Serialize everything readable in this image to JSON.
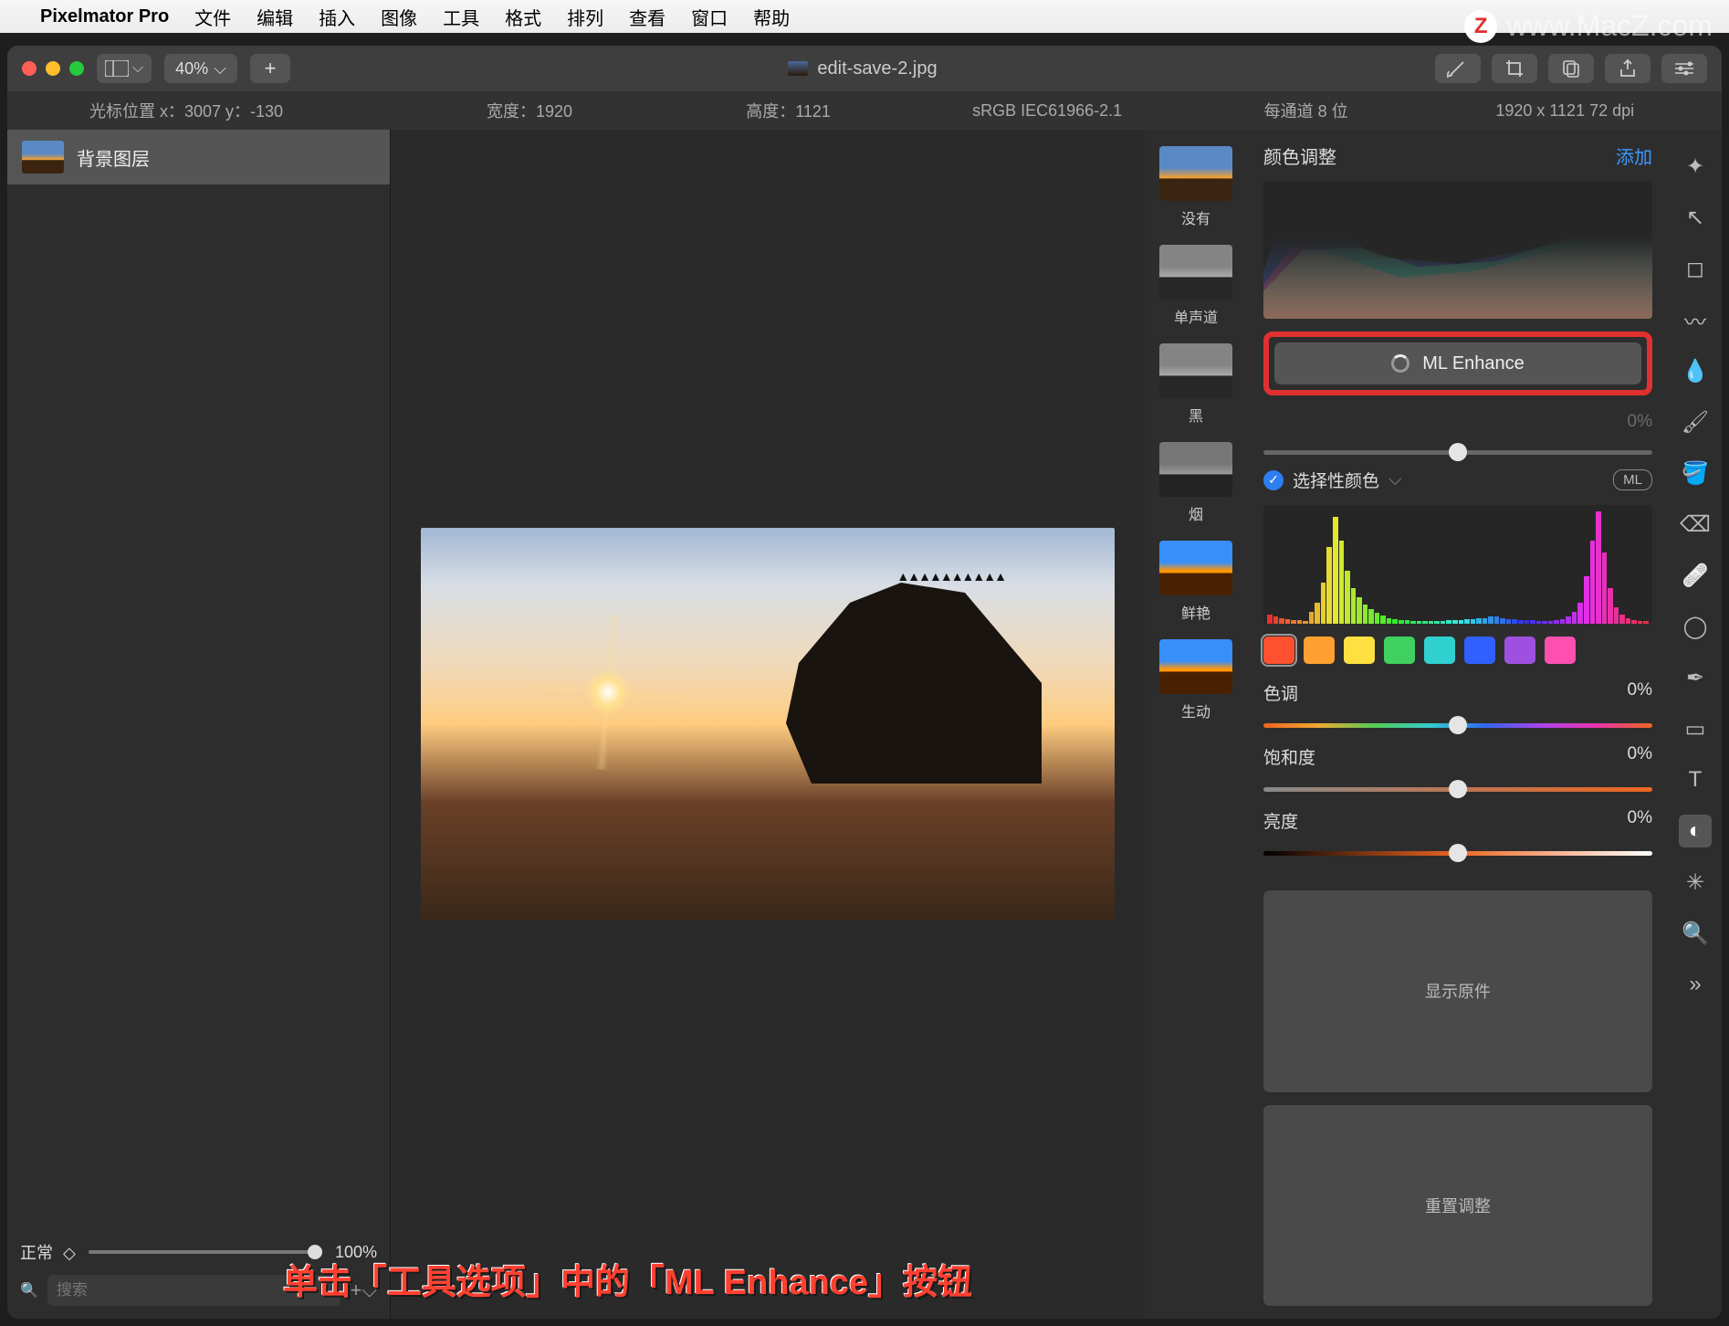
{
  "menubar": {
    "app": "Pixelmator Pro",
    "items": [
      "文件",
      "编辑",
      "插入",
      "图像",
      "工具",
      "格式",
      "排列",
      "查看",
      "窗口",
      "帮助"
    ]
  },
  "watermark": "www.MacZ.com",
  "toolbar": {
    "zoom": "40%",
    "document_title": "edit-save-2.jpg"
  },
  "infobar": {
    "cursor": "光标位置 x：3007    y：-130",
    "width": "宽度：1920",
    "height": "高度：1121",
    "profile": "sRGB IEC61966-2.1",
    "depth": "每通道 8 位",
    "dims": "1920 x 1121 72 dpi"
  },
  "layers": {
    "items": [
      {
        "name": "背景图层"
      }
    ],
    "blend_mode": "正常",
    "opacity": "100%",
    "search_placeholder": "搜索"
  },
  "presets": [
    {
      "key": "none",
      "label": "没有",
      "cls": ""
    },
    {
      "key": "mono",
      "label": "单声道",
      "cls": "bw"
    },
    {
      "key": "black",
      "label": "黑",
      "cls": "bw"
    },
    {
      "key": "smoke",
      "label": "烟",
      "cls": "smoke"
    },
    {
      "key": "vivid",
      "label": "鲜艳",
      "cls": "vivid"
    },
    {
      "key": "live",
      "label": "生动",
      "cls": "vivid"
    }
  ],
  "adjust": {
    "title": "颜色调整",
    "add": "添加",
    "ml_enhance": "ML Enhance",
    "exposure_value": "0%",
    "selective_color": "选择性颜色",
    "ml_badge": "ML",
    "hue_label": "色调",
    "hue_value": "0%",
    "sat_label": "饱和度",
    "sat_value": "0%",
    "lig_label": "亮度",
    "lig_value": "0%",
    "show_original": "显示原件",
    "reset": "重置调整",
    "swatches": [
      "#ff5030",
      "#ffa030",
      "#ffe040",
      "#40d060",
      "#30d0d0",
      "#3060ff",
      "#a050e0",
      "#ff50b0"
    ]
  },
  "annotation": "单击「工具选项」中的「ML Enhance」按钮"
}
